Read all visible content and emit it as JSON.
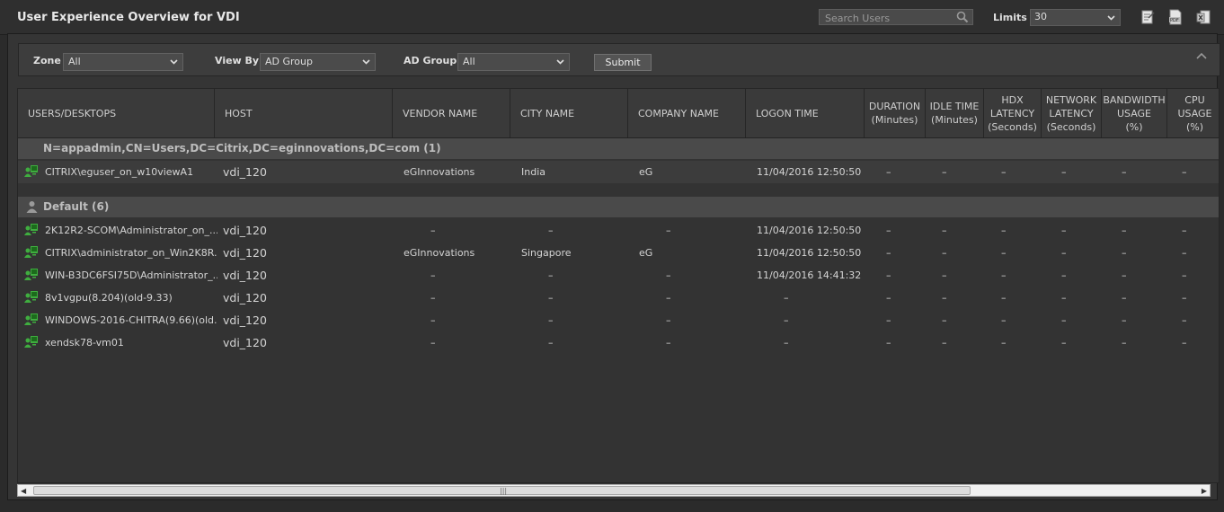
{
  "header": {
    "title": "User Experience Overview for VDI",
    "search_placeholder": "Search Users",
    "limits_label": "Limits",
    "limits_value": "30",
    "icons": [
      "report-icon",
      "pdf-icon",
      "excel-icon"
    ]
  },
  "filters": {
    "zone_label": "Zone",
    "zone_value": "All",
    "viewby_label": "View By",
    "viewby_value": "AD Group",
    "adgroup_label": "AD Group",
    "adgroup_value": "All",
    "submit_label": "Submit"
  },
  "columns": [
    "USERS/DESKTOPS",
    "HOST",
    "VENDOR NAME",
    "CITY NAME",
    "COMPANY NAME",
    "LOGON TIME",
    "DURATION\n(Minutes)",
    "IDLE TIME\n(Minutes)",
    "HDX\nLATENCY\n(Seconds)",
    "NETWORK\nLATENCY\n(Seconds)",
    "BANDWIDTH\nUSAGE\n(%)",
    "CPU\nUSAGE\n(%)"
  ],
  "groups": [
    {
      "name": "N=appadmin,CN=Users,DC=Citrix,DC=eginnovations,DC=com (1)",
      "rows": [
        {
          "user": "CITRIX\\eguser_on_w10viewA1",
          "host": "vdi_120",
          "vendor": "eGInnovations",
          "city": "India",
          "company": "eG",
          "logon": "11/04/2016 12:50:50",
          "duration": "–",
          "idle": "–",
          "hdx": "–",
          "net": "–",
          "bw": "–",
          "cpu": "–"
        }
      ]
    },
    {
      "name": "Default (6)",
      "rows": [
        {
          "user": "2K12R2-SCOM\\Administrator_on_...",
          "host": "vdi_120",
          "vendor": "–",
          "city": "–",
          "company": "–",
          "logon": "11/04/2016 12:50:50",
          "duration": "–",
          "idle": "–",
          "hdx": "–",
          "net": "–",
          "bw": "–",
          "cpu": "–"
        },
        {
          "user": "CITRIX\\administrator_on_Win2K8R...",
          "host": "vdi_120",
          "vendor": "eGInnovations",
          "city": "Singapore",
          "company": "eG",
          "logon": "11/04/2016 12:50:50",
          "duration": "–",
          "idle": "–",
          "hdx": "–",
          "net": "–",
          "bw": "–",
          "cpu": "–"
        },
        {
          "user": "WIN-B3DC6FSI75D\\Administrator_...",
          "host": "vdi_120",
          "vendor": "–",
          "city": "–",
          "company": "–",
          "logon": "11/04/2016 14:41:32",
          "duration": "–",
          "idle": "–",
          "hdx": "–",
          "net": "–",
          "bw": "–",
          "cpu": "–"
        },
        {
          "user": "8v1vgpu(8.204)(old-9.33)",
          "host": "vdi_120",
          "vendor": "–",
          "city": "–",
          "company": "–",
          "logon": "–",
          "duration": "–",
          "idle": "–",
          "hdx": "–",
          "net": "–",
          "bw": "–",
          "cpu": "–"
        },
        {
          "user": "WINDOWS-2016-CHITRA(9.66)(old...",
          "host": "vdi_120",
          "vendor": "–",
          "city": "–",
          "company": "–",
          "logon": "–",
          "duration": "–",
          "idle": "–",
          "hdx": "–",
          "net": "–",
          "bw": "–",
          "cpu": "–"
        },
        {
          "user": "xendsk78-vm01",
          "host": "vdi_120",
          "vendor": "–",
          "city": "–",
          "company": "–",
          "logon": "–",
          "duration": "–",
          "idle": "–",
          "hdx": "–",
          "net": "–",
          "bw": "–",
          "cpu": "–"
        }
      ]
    }
  ],
  "colors": {
    "accent_green": "#3fae3f",
    "group_bg": "#4a4a4a",
    "header_bg": "#3a3a3a"
  }
}
